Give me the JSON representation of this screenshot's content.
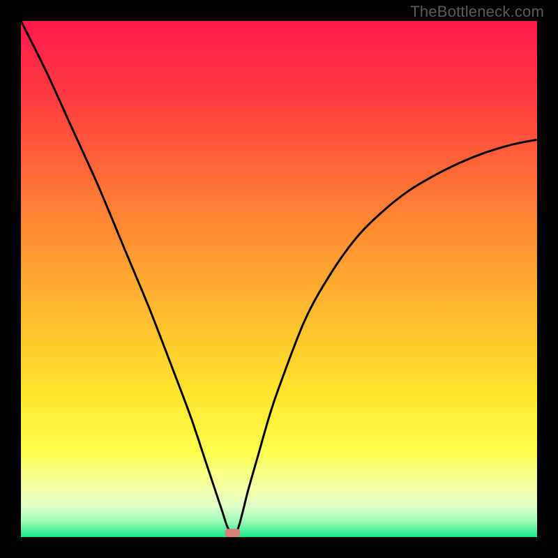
{
  "watermark": "TheBottleneck.com",
  "chart_data": {
    "type": "line",
    "title": "",
    "xlabel": "",
    "ylabel": "",
    "xlim": [
      0,
      100
    ],
    "ylim": [
      0,
      100
    ],
    "curve_minimum_x": 41,
    "marker": {
      "x": 41,
      "y": 0.8,
      "color": "#d97f7b"
    },
    "series": [
      {
        "name": "bottleneck-curve",
        "x": [
          0,
          5,
          10,
          15,
          20,
          25,
          30,
          33,
          36,
          38,
          39,
          40,
          41,
          42,
          43,
          44,
          46,
          48,
          50,
          55,
          60,
          65,
          70,
          75,
          80,
          85,
          90,
          95,
          100
        ],
        "values": [
          100,
          90,
          79,
          68,
          56,
          44,
          31,
          23,
          14,
          8,
          5,
          2,
          0.5,
          1.5,
          5,
          9,
          16,
          23,
          29,
          42,
          51,
          58,
          63,
          67,
          70,
          72.5,
          74.5,
          76,
          77
        ]
      }
    ],
    "background_gradient_stops": [
      {
        "offset": 0,
        "color": "#ff1a4b"
      },
      {
        "offset": 16,
        "color": "#ff3f3f"
      },
      {
        "offset": 35,
        "color": "#ff7c34"
      },
      {
        "offset": 55,
        "color": "#ffb72f"
      },
      {
        "offset": 72,
        "color": "#ffe52d"
      },
      {
        "offset": 83,
        "color": "#fdfe4b"
      },
      {
        "offset": 90,
        "color": "#f4ffa0"
      },
      {
        "offset": 94,
        "color": "#e0ffc4"
      },
      {
        "offset": 97,
        "color": "#9dfcb7"
      },
      {
        "offset": 100,
        "color": "#17e98a"
      }
    ]
  }
}
